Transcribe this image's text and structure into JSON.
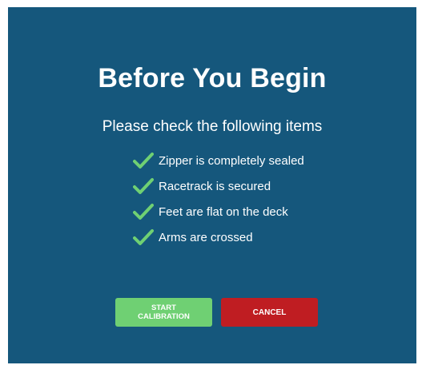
{
  "dialog": {
    "title": "Before You Begin",
    "subtitle": "Please check the following items",
    "checklist": [
      {
        "label": "Zipper is completely sealed",
        "icon": "checkmark-icon"
      },
      {
        "label": "Racetrack is secured",
        "icon": "checkmark-icon"
      },
      {
        "label": "Feet are flat on the deck",
        "icon": "checkmark-icon"
      },
      {
        "label": "Arms are crossed",
        "icon": "checkmark-icon"
      }
    ],
    "start_button": "START\nCALIBRATION",
    "cancel_button": "CANCEL"
  },
  "colors": {
    "background": "#15577c",
    "check": "#6fd073",
    "start_button": "#6fd073",
    "cancel_button": "#bf1d22",
    "text": "#ffffff"
  }
}
